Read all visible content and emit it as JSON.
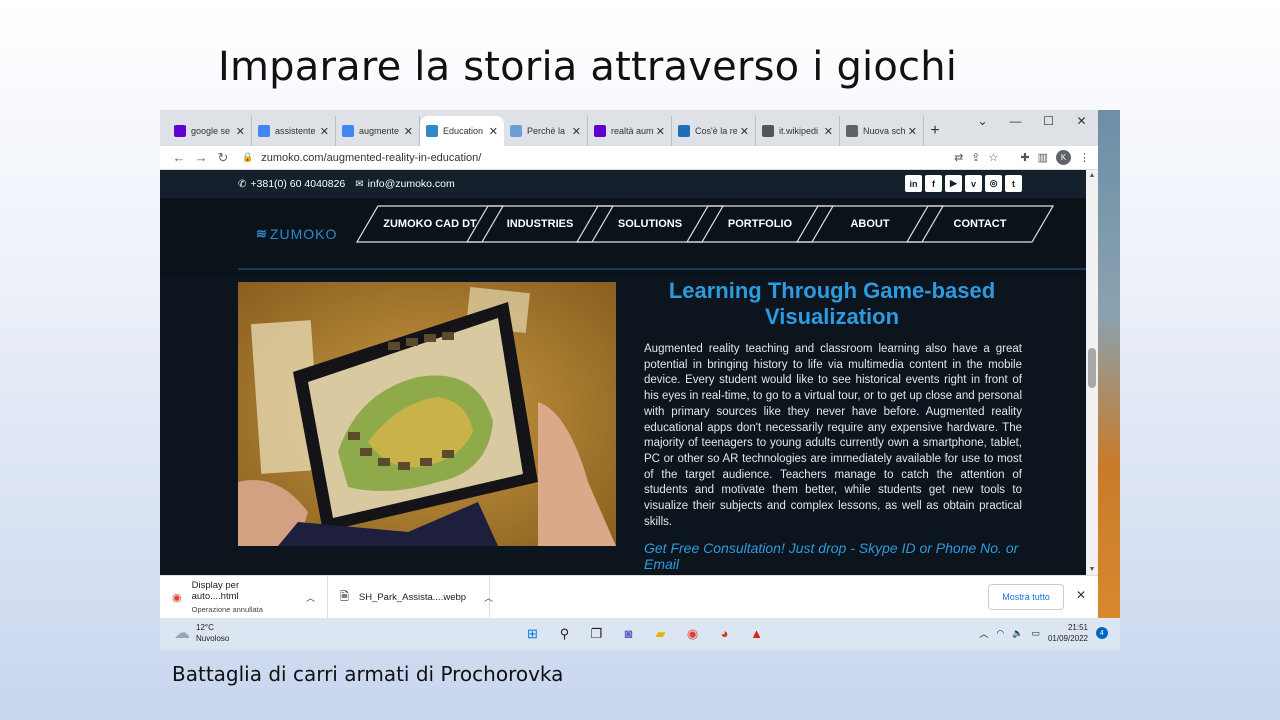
{
  "slide": {
    "title": "Imparare la storia attraverso i giochi",
    "caption": "Battaglia di carri armati di Prochorovka"
  },
  "browser": {
    "tabs": [
      {
        "label": "google se",
        "icon": "yahoo-icon",
        "color": "#6001d2",
        "active": false
      },
      {
        "label": "assistente",
        "icon": "google-icon",
        "color": "#4285f4",
        "active": false
      },
      {
        "label": "augmente",
        "icon": "google-icon",
        "color": "#4285f4",
        "active": false
      },
      {
        "label": "Education",
        "icon": "zumoko-icon",
        "color": "#2f88c9",
        "active": true
      },
      {
        "label": "Perchè la",
        "icon": "globe-icon",
        "color": "#6aa0d8",
        "active": false
      },
      {
        "label": "realtà aum",
        "icon": "yahoo-icon",
        "color": "#6001d2",
        "active": false
      },
      {
        "label": "Cos'è la re",
        "icon": "site-icon",
        "color": "#1d6fb8",
        "active": false
      },
      {
        "label": "it.wikipedi",
        "icon": "wikipedia-icon",
        "color": "#555555",
        "active": false
      },
      {
        "label": "Nuova sch",
        "icon": "globe-icon",
        "color": "#5f6368",
        "active": false
      }
    ],
    "url": "zumoko.com/augmented-reality-in-education/",
    "profile_initial": "K"
  },
  "site": {
    "phone": "+381(0) 60 4040826",
    "email": "info@zumoko.com",
    "social": [
      "in",
      "f",
      "▶",
      "v",
      "◎",
      "t"
    ],
    "logo": "ZUMOKO",
    "menu": [
      "ZUMOKO CAD DT",
      "INDUSTRIES",
      "SOLUTIONS",
      "PORTFOLIO",
      "ABOUT",
      "CONTACT"
    ],
    "heading": "Learning Through Game-based Visualization",
    "body": "Augmented reality teaching and classroom learning also have a great potential in bringing history to life via multimedia content in the mobile device. Every student would like to see historical events right in front of his eyes in real-time, to go to a virtual tour, or to get up close and personal with primary sources like they never have before. Augmented reality educational apps don't necessarily require any expensive hardware. The majority of teenagers to young adults currently own a smartphone, tablet, PC or other so AR technologies are immediately available for use to most of the target audience. Teachers manage to catch the attention of students and motivate them better, while students get new tools to visualize their subjects and complex lessons, as well as obtain practical skills.",
    "cta": "Get Free Consultation! Just drop - Skype ID or Phone No. or Email"
  },
  "downloads": {
    "items": [
      {
        "name": "Display per auto....html",
        "status": "Operazione annullata"
      },
      {
        "name": "SH_Park_Assista....webp",
        "status": ""
      }
    ],
    "show_all": "Mostra tutto"
  },
  "taskbar": {
    "temp": "12°C",
    "weather": "Nuvoloso",
    "time": "21:51",
    "date": "01/09/2022",
    "notifications": "4"
  },
  "colors": {
    "accent": "#2e9ae0",
    "site_bg": "#0c151d"
  }
}
